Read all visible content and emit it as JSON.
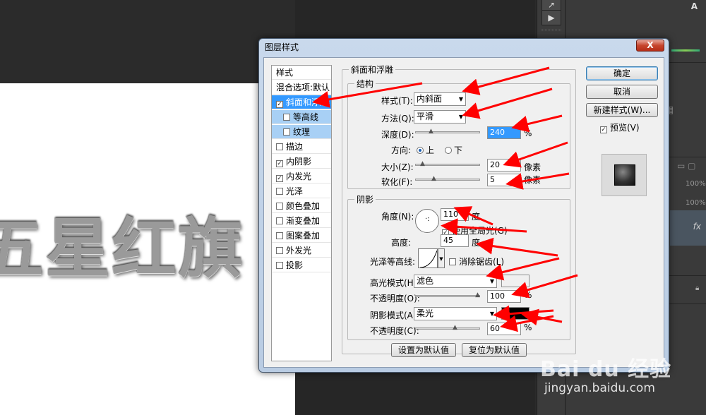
{
  "canvas": {
    "text": "五星红旗"
  },
  "right_panel": {
    "pct1": "100%",
    "pct2": "100%",
    "fx": "fx",
    "warn": "A"
  },
  "dialog": {
    "title": "图层样式",
    "close": "X",
    "styles_list": {
      "header": "样式",
      "items": [
        {
          "label": "混合选项:默认",
          "checked": null
        },
        {
          "label": "斜面和浮雕",
          "checked": true
        },
        {
          "label": "等高线",
          "checked": false
        },
        {
          "label": "纹理",
          "checked": false
        },
        {
          "label": "描边",
          "checked": false
        },
        {
          "label": "内阴影",
          "checked": true
        },
        {
          "label": "内发光",
          "checked": true
        },
        {
          "label": "光泽",
          "checked": false
        },
        {
          "label": "颜色叠加",
          "checked": false
        },
        {
          "label": "渐变叠加",
          "checked": false
        },
        {
          "label": "图案叠加",
          "checked": false
        },
        {
          "label": "外发光",
          "checked": false
        },
        {
          "label": "投影",
          "checked": false
        }
      ]
    },
    "bevel": {
      "group_title": "斜面和浮雕",
      "structure_title": "结构",
      "style_label": "样式(T):",
      "style_value": "内斜面",
      "method_label": "方法(Q):",
      "method_value": "平滑",
      "depth_label": "深度(D):",
      "depth_value": "240",
      "depth_unit": "%",
      "direction_label": "方向:",
      "direction_up": "上",
      "direction_down": "下",
      "size_label": "大小(Z):",
      "size_value": "20",
      "size_unit": "像素",
      "soften_label": "软化(F):",
      "soften_value": "5",
      "soften_unit": "像素"
    },
    "shading": {
      "title": "阴影",
      "angle_label": "角度(N):",
      "angle_value": "110",
      "angle_unit": "度",
      "global_light": "使用全局光(G)",
      "altitude_label": "高度:",
      "altitude_value": "45",
      "altitude_unit": "度",
      "gloss_label": "光泽等高线:",
      "antialias": "消除锯齿(L)",
      "highlight_mode_label": "高光模式(H):",
      "highlight_mode_value": "滤色",
      "highlight_opacity_label": "不透明度(O):",
      "highlight_opacity_value": "100",
      "highlight_opacity_unit": "%",
      "shadow_mode_label": "阴影模式(A):",
      "shadow_mode_value": "柔光",
      "shadow_opacity_label": "不透明度(C):",
      "shadow_opacity_value": "60",
      "shadow_opacity_unit": "%",
      "highlight_color": "#ffffff",
      "shadow_color": "#000000"
    },
    "buttons": {
      "set_default": "设置为默认值",
      "reset_default": "复位为默认值",
      "ok": "确定",
      "cancel": "取消",
      "new_style": "新建样式(W)...",
      "preview": "预览(V)"
    }
  },
  "watermark": {
    "logo": "Bai du 经验",
    "url": "jingyan.baidu.com"
  },
  "colors": {
    "accent": "#3399ff",
    "arrow": "#ff0000"
  }
}
